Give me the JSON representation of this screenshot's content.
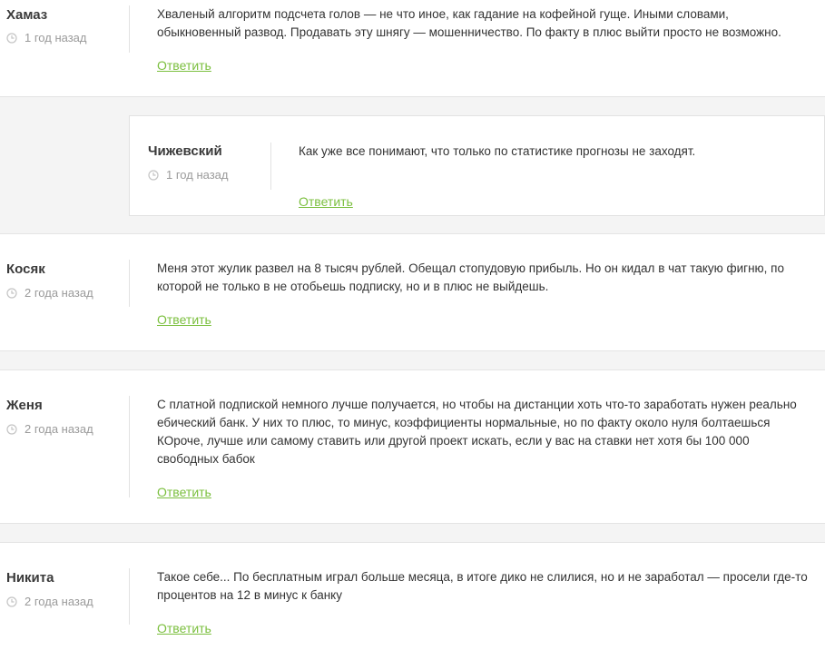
{
  "comments": [
    {
      "author": "Хамаз",
      "time": "1 год назад",
      "lines": [
        "Хваленый алгоритм подсчета голов — не что иное, как гадание на кофейной гуще. Иными словами,",
        "обыкновенный развод. Продавать эту шнягу — мошенничество. По факту в плюс выйти просто не возможно."
      ],
      "reply": "Ответить"
    },
    {
      "author": "Чижевский",
      "time": "1 год назад",
      "lines": [
        "Как уже все понимают, что только по статистике прогнозы не заходят."
      ],
      "reply": "Ответить"
    },
    {
      "author": "Косяк",
      "time": "2 года назад",
      "lines": [
        "Меня этот жулик развел на 8 тысяч рублей. Обещал стопудовую прибыль. Но он кидал в чат такую фигню, по",
        "которой не только в не отобьешь подписку, но и в плюс не выйдешь."
      ],
      "reply": "Ответить"
    },
    {
      "author": "Женя",
      "time": "2 года назад",
      "lines": [
        "С платной подпиской немного лучше получается, но чтобы на дистанции хоть что-то заработать нужен реально",
        "ебический банк. У них то плюс, то минус, коэффициенты нормальные, но по факту около нуля болтаешься",
        "КОроче, лучше или самому ставить или другой проект искать, если у вас на ставки нет хотя бы 100 000",
        "свободных бабок"
      ],
      "reply": "Ответить"
    },
    {
      "author": "Никита",
      "time": "2 года назад",
      "lines": [
        "Такое себе... По бесплатным играл больше месяца, в итоге дико не слилися, но и не заработал — просели где-то",
        "процентов на 12 в минус к банку"
      ],
      "reply": "Ответить"
    }
  ],
  "colors": {
    "accent": "#7bbf3e",
    "muted": "#9a9a9a",
    "gap_background": "#f4f4f4"
  }
}
